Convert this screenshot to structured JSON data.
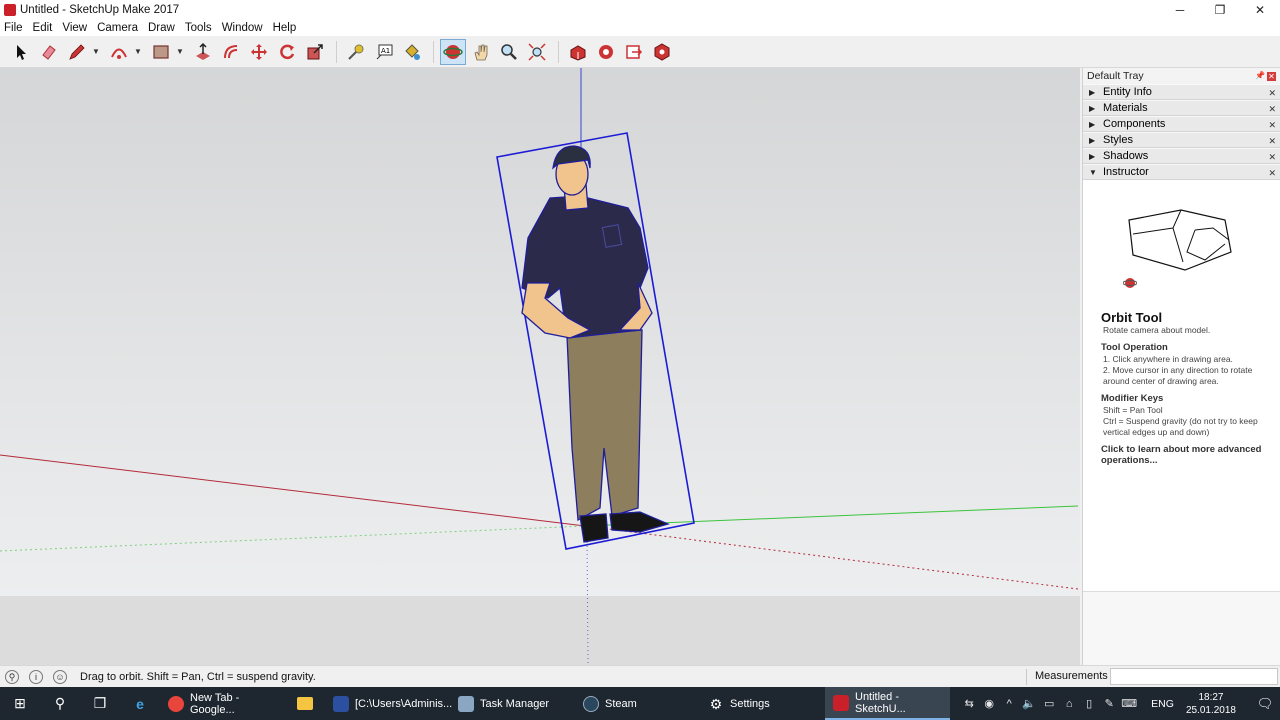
{
  "window": {
    "title": "Untitled - SketchUp Make 2017",
    "controls": {
      "minimize": "─",
      "restore": "❐",
      "close": "✕"
    }
  },
  "menu": [
    "File",
    "Edit",
    "View",
    "Camera",
    "Draw",
    "Tools",
    "Window",
    "Help"
  ],
  "toolbar": {
    "tools": [
      "select-tool",
      "eraser-tool",
      "pencil-line-tool",
      "arc-tool",
      "rectangle-tool",
      "push-pull-tool",
      "offset-tool",
      "move-tool",
      "rotate-tool",
      "scale-tool",
      "tape-measure-tool",
      "text-tool",
      "paint-bucket-tool",
      "orbit-tool",
      "pan-tool",
      "zoom-tool",
      "zoom-extents-tool",
      "warehouse-tool",
      "extension-warehouse-tool",
      "send-to-layout-tool",
      "extension-manager-tool"
    ],
    "active_tool": "orbit-tool"
  },
  "tray": {
    "title": "Default Tray",
    "panels": [
      {
        "label": "Entity Info",
        "expanded": false
      },
      {
        "label": "Materials",
        "expanded": false
      },
      {
        "label": "Components",
        "expanded": false
      },
      {
        "label": "Styles",
        "expanded": false
      },
      {
        "label": "Shadows",
        "expanded": false
      },
      {
        "label": "Instructor",
        "expanded": true
      }
    ],
    "instructor": {
      "tool_name": "Orbit Tool",
      "tool_desc": "Rotate camera about model.",
      "operation_heading": "Tool Operation",
      "operation_steps": [
        "1.  Click anywhere in drawing area.",
        "2.  Move cursor in any direction to rotate",
        "     around center of drawing area."
      ],
      "modifier_heading": "Modifier Keys",
      "modifier_lines": [
        "Shift = Pan Tool",
        "Ctrl = Suspend gravity (do not try to keep",
        "vertical edges up and down)"
      ],
      "learn_more": "Click to learn about more advanced operations..."
    }
  },
  "status": {
    "message": "Drag to orbit. Shift = Pan, Ctrl = suspend gravity.",
    "measurements_label": "Measurements",
    "measurements_value": ""
  },
  "taskbar": {
    "apps": [
      {
        "label": "New Tab - Google...",
        "color": "#e8453c",
        "active": false
      },
      {
        "label": "",
        "color": "#f5c542",
        "active": false
      },
      {
        "label": "[C:\\Users\\Adminis...",
        "color": "#2d4fa0",
        "active": false
      },
      {
        "label": "Task Manager",
        "color": "#8aa6c1",
        "active": false
      },
      {
        "label": "Steam",
        "color": "#2a475e",
        "active": false
      },
      {
        "label": "Settings",
        "color": "#ffffff",
        "active": false
      },
      {
        "label": "Untitled - SketchU...",
        "color": "#c9202a",
        "active": true
      }
    ],
    "language": "ENG",
    "time": "18:27",
    "date": "25.01.2018"
  }
}
